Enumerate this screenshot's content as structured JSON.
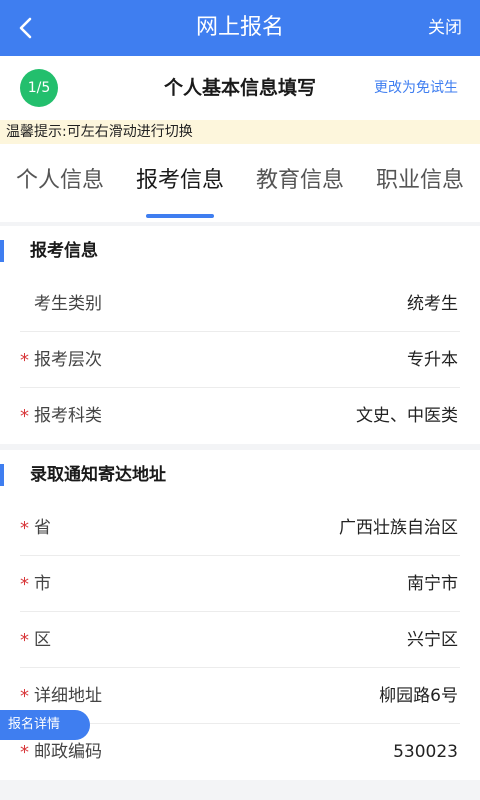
{
  "topbar": {
    "title": "网上报名",
    "close_label": "关闭",
    "back_icon": "chevron-left-icon"
  },
  "header": {
    "step": "1/5",
    "title": "个人基本信息填写",
    "switch_label": "更改为免试生"
  },
  "tip": "温馨提示:可左右滑动进行切换",
  "tabs": [
    {
      "label": "个人信息",
      "active": false
    },
    {
      "label": "报考信息",
      "active": true
    },
    {
      "label": "教育信息",
      "active": false
    },
    {
      "label": "职业信息",
      "active": false
    }
  ],
  "exam_section": {
    "title": "报考信息",
    "rows": [
      {
        "label": "考生类别",
        "value": "统考生",
        "required": false
      },
      {
        "label": "报考层次",
        "value": "专升本",
        "required": true
      },
      {
        "label": "报考科类",
        "value": "文史、中医类",
        "required": true
      }
    ]
  },
  "address_section": {
    "title": "录取通知寄达地址",
    "rows": [
      {
        "label": "省",
        "value": "广西壮族自治区",
        "required": true
      },
      {
        "label": "市",
        "value": "南宁市",
        "required": true
      },
      {
        "label": "区",
        "value": "兴宁区",
        "required": true
      },
      {
        "label": "详细地址",
        "value": "柳园路6号",
        "required": true
      },
      {
        "label": "邮政编码",
        "value": "530023",
        "required": true
      }
    ]
  },
  "float_button": "报名详情",
  "required_mark": "*",
  "colors": {
    "primary": "#3f7ef0",
    "step_badge": "#23bf6d",
    "required": "#d8373a",
    "tip_bg": "#fdf6dc"
  }
}
